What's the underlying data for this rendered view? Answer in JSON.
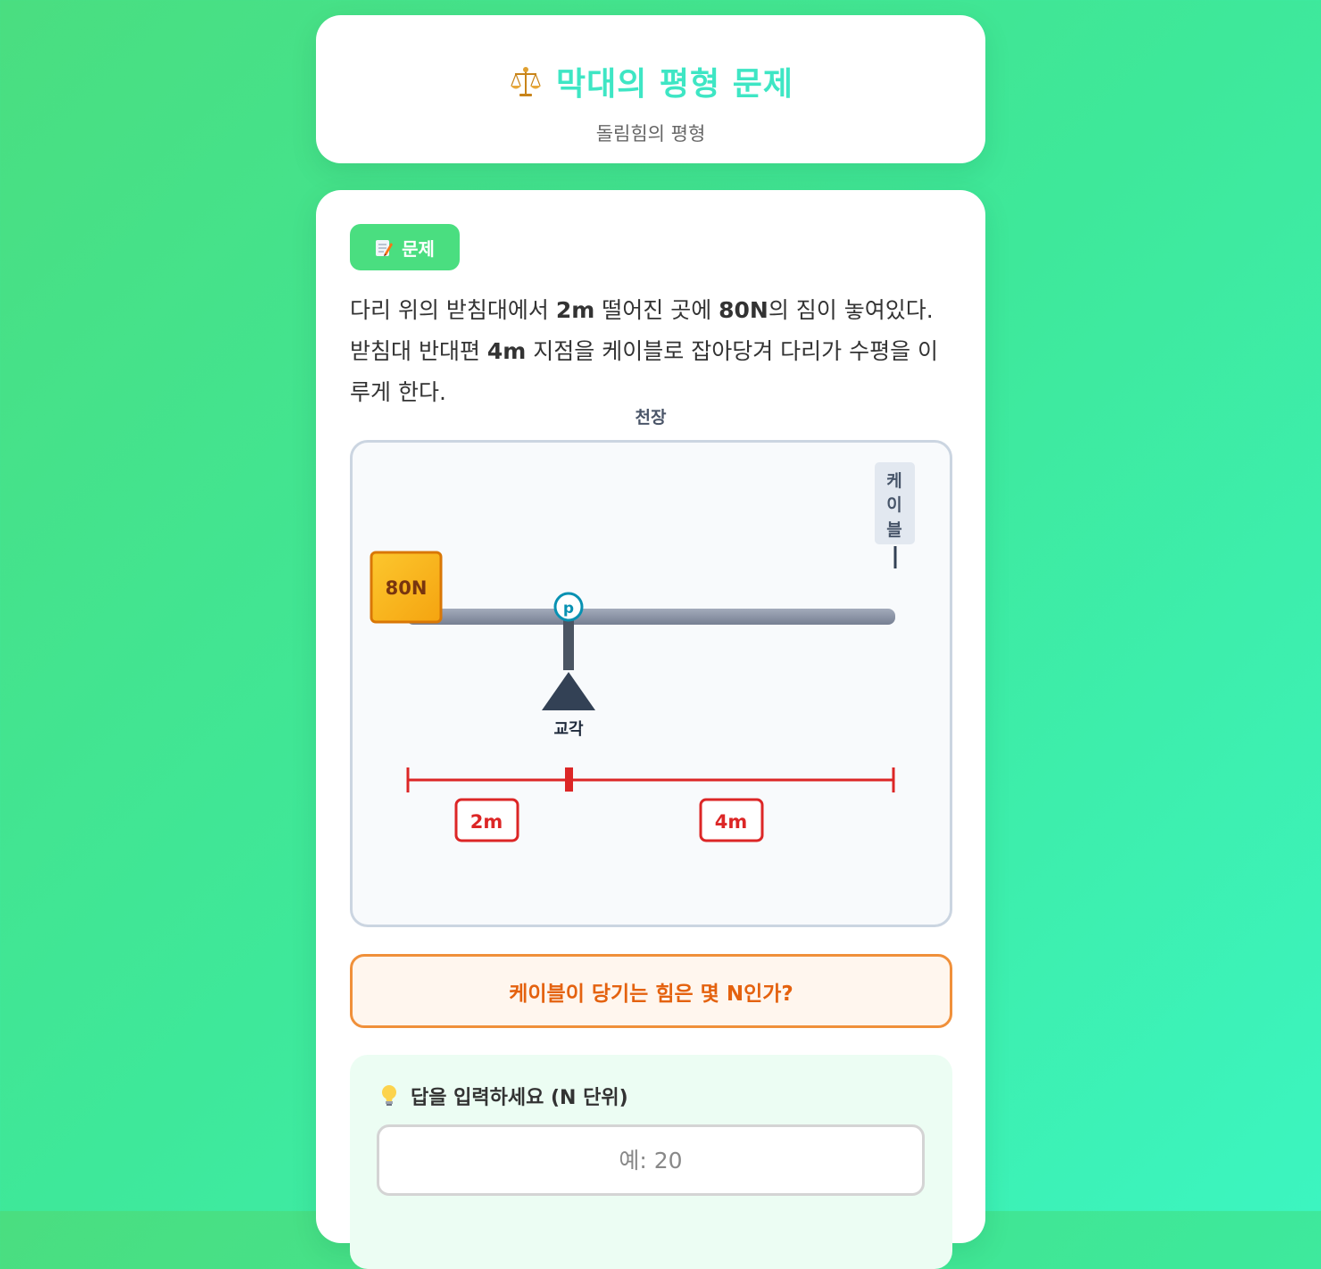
{
  "header": {
    "icon": "balance-scale-icon",
    "title": "막대의 평형 문제",
    "subtitle": "돌림힘의 평형"
  },
  "problem": {
    "badge_icon": "memo-icon",
    "badge_label": "문제",
    "text_parts": {
      "p1": "다리 위의 받침대에서 ",
      "b1": "2m",
      "p2": " 떨어진 곳에 ",
      "b2": "80N",
      "p3": "의 짐이 놓여있다. 받침대 반대편 ",
      "b3": "4m",
      "p4": " 지점을 케이블로 잡아당겨 다리가 수평을 이루게 한다."
    }
  },
  "diagram": {
    "ceiling_label": "천장",
    "cable_label": [
      "케",
      "이",
      "블"
    ],
    "weight_label": "80N",
    "pivot_label": "p",
    "support_label": "교각",
    "distance_left": "2m",
    "distance_right": "4m",
    "colors": {
      "weight_fill": "#fbbf24",
      "weight_border": "#d97706",
      "beam": "#8a93a6",
      "pivot_ring": "#0891b2",
      "support": "#334155",
      "measure": "#dc2626"
    }
  },
  "question": {
    "text": "케이블이 당기는 힘은 몇 N인가?"
  },
  "answer": {
    "icon": "lightbulb-icon",
    "label": "답을 입력하세요 (N 단위)",
    "placeholder": "예: 20",
    "value": ""
  }
}
